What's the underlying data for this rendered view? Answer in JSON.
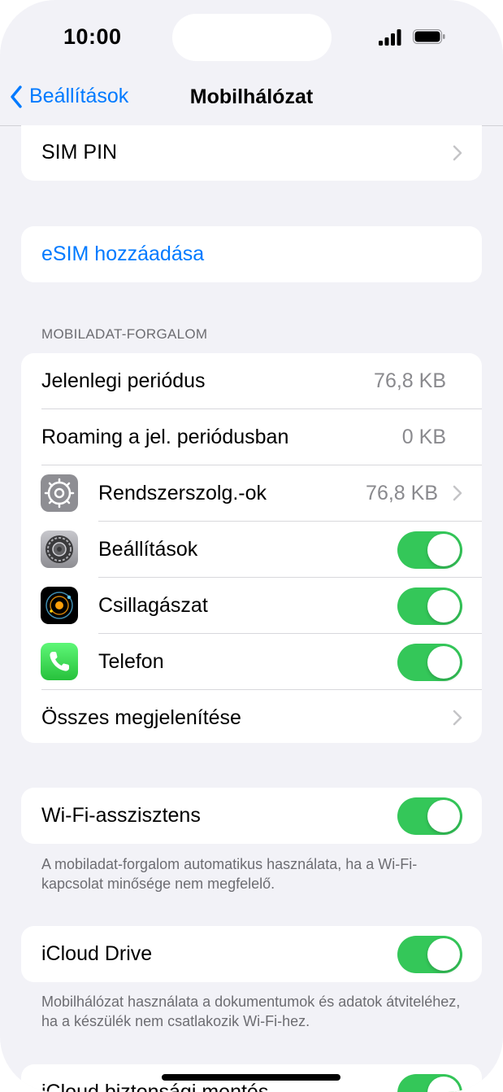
{
  "status_bar": {
    "time": "10:00"
  },
  "nav": {
    "back_label": "Beállítások",
    "title": "Mobilhálózat"
  },
  "sim_pin": {
    "label": "SIM PIN"
  },
  "esim": {
    "label": "eSIM hozzáadása"
  },
  "usage": {
    "header": "MOBILADAT-FORGALOM",
    "current_label": "Jelenlegi periódus",
    "current_value": "76,8 KB",
    "roaming_label": "Roaming a jel. periódusban",
    "roaming_value": "0 KB",
    "apps": [
      {
        "name": "Rendszerszolg.-ok",
        "value": "76,8 KB",
        "icon": "gear-outline-icon"
      },
      {
        "name": "Beállítások",
        "toggle": true,
        "icon": "settings-gear-icon"
      },
      {
        "name": "Csillagászat",
        "toggle": true,
        "icon": "astronomy-icon"
      },
      {
        "name": "Telefon",
        "toggle": true,
        "icon": "phone-icon"
      }
    ],
    "show_all_label": "Összes megjelenítése"
  },
  "wifi_assist": {
    "label": "Wi-Fi-asszisztens",
    "on": true,
    "footer": "A mobiladat-forgalom automatikus használata, ha a Wi-Fi-kapcsolat minősége nem megfelelő."
  },
  "icloud_drive": {
    "label": "iCloud Drive",
    "on": true,
    "footer": "Mobilhálózat használata a dokumentumok és adatok átviteléhez, ha a készülék nem csatlakozik Wi-Fi-hez."
  },
  "icloud_backup": {
    "label": "iCloud biztonsági mentés",
    "on": true
  },
  "colors": {
    "accent": "#007aff",
    "toggle_on": "#34c759",
    "background": "#f2f2f7"
  }
}
